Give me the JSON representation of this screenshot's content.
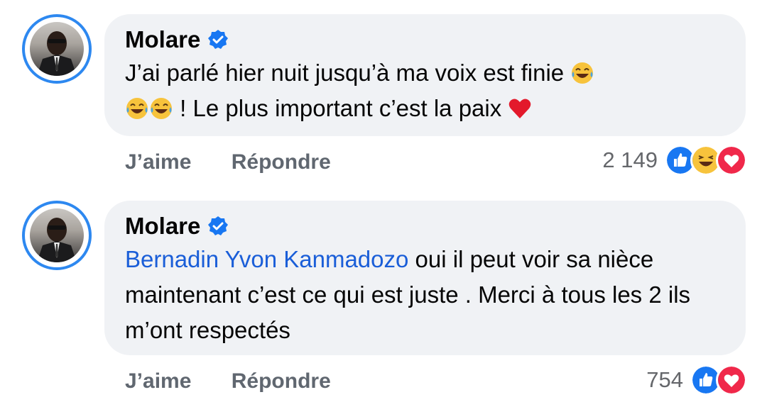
{
  "comments": [
    {
      "author": "Molare",
      "text_parts": [
        "J’ai parlé hier nuit jusqu’à ma voix est finie",
        "! Le plus important c’est la paix"
      ],
      "actions": {
        "like": "J’aime",
        "reply": "Répondre"
      },
      "reaction_count": "2 149",
      "reactions": [
        "like-icon",
        "haha-icon",
        "love-icon"
      ]
    },
    {
      "author": "Molare",
      "mention": "Bernadin Yvon Kanmadozo",
      "text": "oui il peut voir sa nièce maintenant c’est ce qui est juste . Merci à tous les 2 ils m’ont respectés",
      "actions": {
        "like": "J’aime",
        "reply": "Répondre"
      },
      "reaction_count": "754",
      "reactions": [
        "like-icon",
        "love-icon"
      ]
    }
  ],
  "colors": {
    "bubble": "#f0f2f5",
    "mention": "#1a5ed8",
    "verified": "#1877f2",
    "avatar_ring": "#2d88f0",
    "action_text": "#606770"
  }
}
